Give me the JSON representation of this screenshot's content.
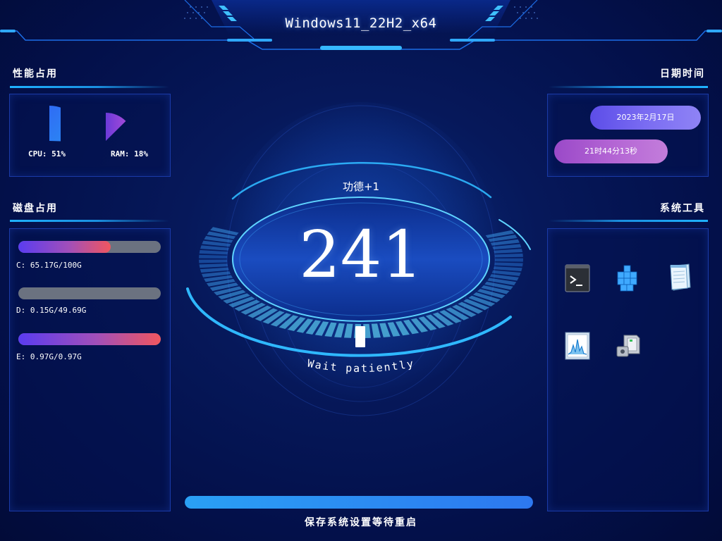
{
  "header": {
    "title": "Windows11_22H2_x64"
  },
  "performance": {
    "title": "性能占用",
    "cpu_label": "CPU: 51%",
    "cpu_value": 51,
    "ram_label": "RAM: 18%",
    "ram_value": 18
  },
  "disk": {
    "title": "磁盘占用",
    "items": [
      {
        "label": "C: 65.17G/100G",
        "fill": 0.65
      },
      {
        "label": "D: 0.15G/49.69G",
        "fill": 0.0
      },
      {
        "label": "E: 0.97G/0.97G",
        "fill": 1.0
      }
    ]
  },
  "datetime": {
    "title": "日期时间",
    "date": "2023年2月17日",
    "time": "21时44分13秒"
  },
  "tools": {
    "title": "系统工具",
    "items": [
      {
        "icon": "terminal-icon"
      },
      {
        "icon": "registry-icon"
      },
      {
        "icon": "notepad-icon"
      },
      {
        "icon": "performance-monitor-icon"
      },
      {
        "icon": "device-manager-icon"
      }
    ]
  },
  "center": {
    "merit": "功德+1",
    "counter": "241",
    "caption": "Wait patiently"
  },
  "footer": {
    "progress": 1.0,
    "status": "保存系统设置等待重启"
  },
  "colors": {
    "accent": "#1fb2ff",
    "panel_border": "#1a3aa8",
    "date_pill": "#6d5fef",
    "time_pill": "#b060d2",
    "disk_gradient_start": "#5a3cf0",
    "disk_gradient_end": "#f0565f"
  }
}
